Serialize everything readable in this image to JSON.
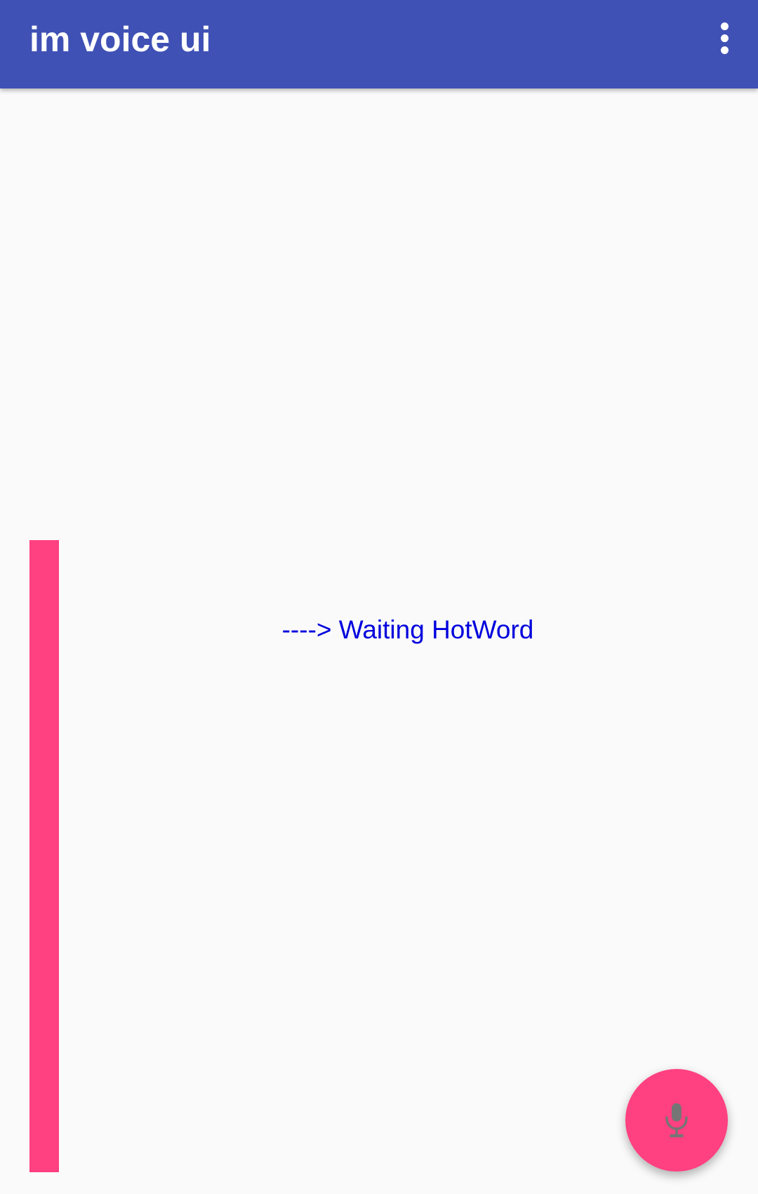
{
  "app_bar": {
    "title": "im voice ui",
    "background_color": "#3f51b5",
    "overflow_icon": "more-vert-icon"
  },
  "main": {
    "status_text": "----> Waiting HotWord",
    "status_color": "#0000dd",
    "level_bar_color": "#ff4081"
  },
  "fab": {
    "icon": "microphone-icon",
    "color": "#ff4081"
  }
}
